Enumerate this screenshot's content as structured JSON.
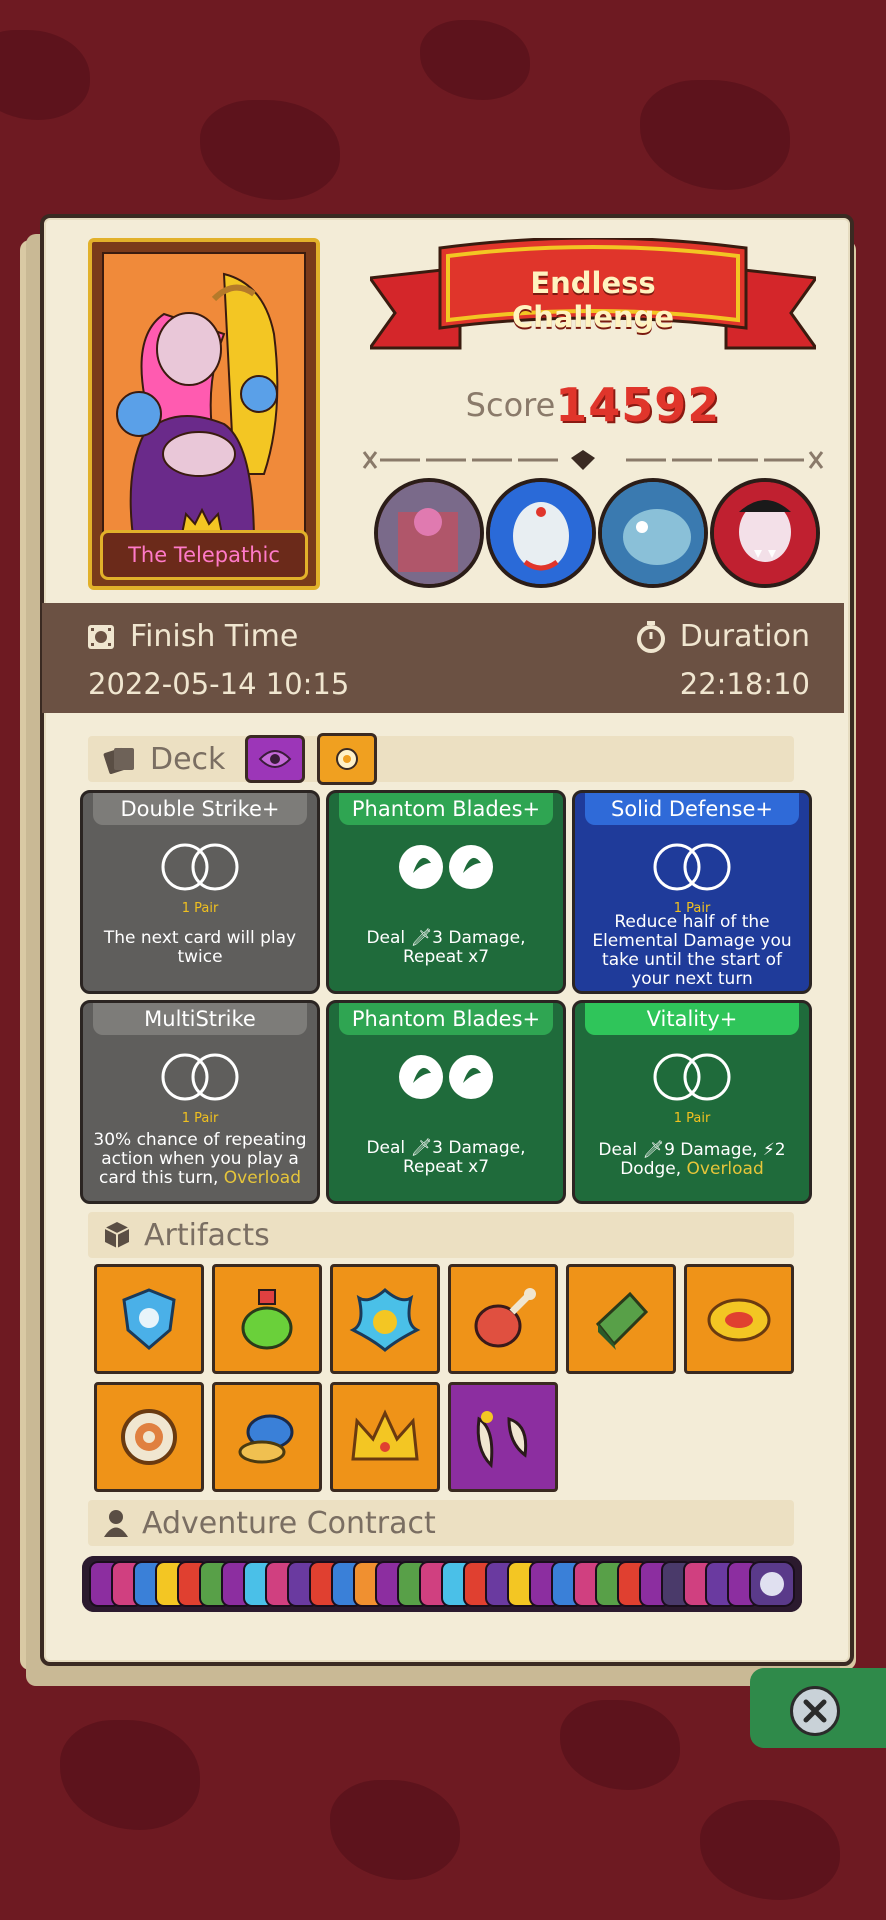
{
  "character": {
    "name": "The Telepathic"
  },
  "challenge": {
    "title": "Endless Challenge",
    "score_label": "Score",
    "score_value": "14592"
  },
  "info": {
    "finish_time_label": "Finish Time",
    "finish_time_value": "2022-05-14 10:15",
    "duration_label": "Duration",
    "duration_value": "22:18:10"
  },
  "deck": {
    "label": "Deck",
    "cards": [
      {
        "title": "Double Strike+",
        "pair": "1 Pair",
        "desc": "The next card will play twice",
        "keyword": ""
      },
      {
        "title": "Phantom Blades+",
        "pair": "",
        "desc": "Deal 🗡3 Damage, Repeat x7",
        "keyword": ""
      },
      {
        "title": "Solid Defense+",
        "pair": "1 Pair",
        "desc": "Reduce half of the Elemental Damage you take until the start of your next turn",
        "keyword": ""
      },
      {
        "title": "MultiStrike",
        "pair": "1 Pair",
        "desc": "30% chance of repeating action when you play a card this turn,",
        "keyword": "Overload"
      },
      {
        "title": "Phantom Blades+",
        "pair": "",
        "desc": "Deal 🗡3 Damage, Repeat x7",
        "keyword": ""
      },
      {
        "title": "Vitality+",
        "pair": "1 Pair",
        "desc": "Deal 🗡9 Damage, ⚡2 Dodge,",
        "keyword": "Overload"
      }
    ]
  },
  "artifacts": {
    "label": "Artifacts"
  },
  "contract": {
    "label": "Adventure Contract"
  },
  "colors": {
    "grey_card": "#5f5e5c",
    "green_card": "#1f6b3b",
    "blue_card": "#1f3b9a",
    "score_red": "#e0352b",
    "artifact_orange": "#ef9318"
  }
}
